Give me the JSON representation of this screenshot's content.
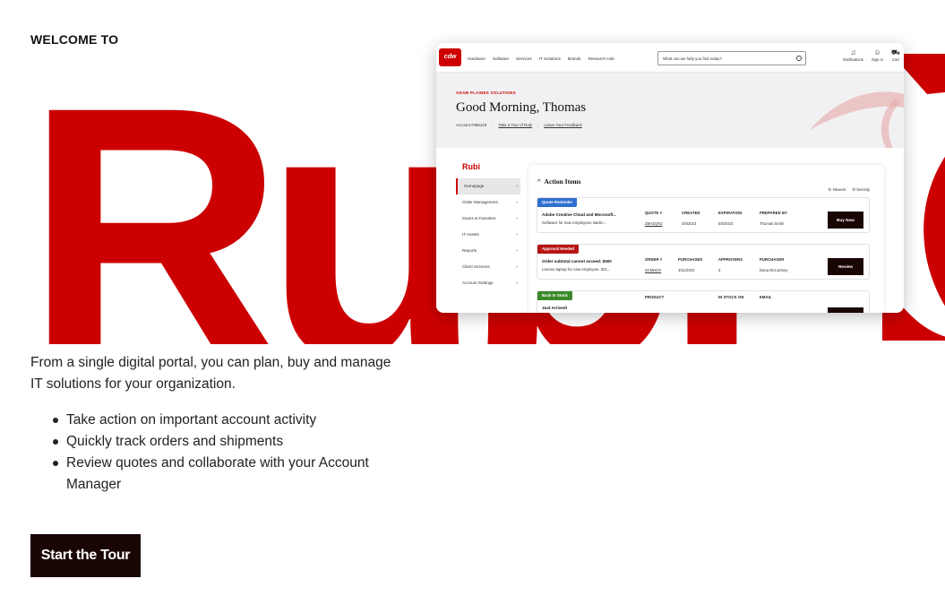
{
  "welcome": "WELCOME TO",
  "hero": {
    "word": "Rubi",
    "registered": "®"
  },
  "intro": "From a single digital portal, you can plan, buy and manage IT solutions for your organization.",
  "bullets": [
    "Take action on important account activity",
    "Quickly track orders and shipments",
    "Review quotes and collaborate with your Account Manager"
  ],
  "cta": "Start the Tour",
  "colors": {
    "brand_red": "#cc0000",
    "dark_button": "#1a0505"
  },
  "screenshot": {
    "logo": "cdw",
    "nav": [
      "Hardware",
      "Software",
      "Services",
      "IT Solutions",
      "Brands",
      "Research Hub"
    ],
    "search_placeholder": "What can we help you find today?",
    "actions": [
      {
        "icon": "bell-icon",
        "glyph": "♫",
        "label": "Notifications"
      },
      {
        "icon": "user-icon",
        "glyph": "☺",
        "label": "Sign In"
      },
      {
        "icon": "cart-icon",
        "glyph": "⛟",
        "label": "Cart"
      }
    ],
    "eyebrow": "ADAM PLAINES SOLUTIONS",
    "greeting": "Good Morning, Thomas",
    "account": "Account #456123",
    "tour_link": "Take a Tour of Rubi",
    "feedback_link": "Leave Your Feedback",
    "sidebar_logo": "Rubi",
    "sidebar": [
      "Homepage",
      "Order Management",
      "Saves & Favorites",
      "IT Assets",
      "Reports",
      "Client Services",
      "Account Settings"
    ],
    "action_items_title": "Action Items",
    "sort_newest": "Newest",
    "sort_density": "Density",
    "items": [
      {
        "badge": "Quote Reminder",
        "badge_color": "#2f6fcf",
        "title": "Adobe Creative Cloud and Microsoft...",
        "subtitle": "Software for new employees startin...",
        "cols": [
          {
            "h": "QUOTE #",
            "v": "ZBHZQN2",
            "link": true
          },
          {
            "h": "CREATED",
            "v": "4/5/2023",
            "link": false
          },
          {
            "h": "EXPIRATION",
            "v": "5/6/2023",
            "link": false
          },
          {
            "h": "PREPARED BY",
            "v": "Thomas Smith",
            "link": false
          }
        ],
        "button": "Buy Now"
      },
      {
        "badge": "Approval Needed",
        "badge_color": "#b81414",
        "title": "Order subtotal cannot exceed: $500",
        "subtitle": "Lenovo laptop for new employee. ID1...",
        "cols": [
          {
            "h": "ORDER #",
            "v": "SCMHDX",
            "link": true
          },
          {
            "h": "PURCHASED",
            "v": "4/11/2023",
            "link": false
          },
          {
            "h": "APPROVERS",
            "v": "3",
            "link": false
          },
          {
            "h": "PURCHASER",
            "v": "Dana McCartney",
            "link": false
          }
        ],
        "button": "Review"
      },
      {
        "badge": "Back In Stock",
        "badge_color": "#3a8a2a",
        "title": "Just Arrived!",
        "subtitle": "",
        "cols": [
          {
            "h": "PRODUCT",
            "v": "",
            "link": false
          },
          {
            "h": "",
            "v": "",
            "link": false
          },
          {
            "h": "IN STOCK ON",
            "v": "",
            "link": false
          },
          {
            "h": "EMAIL",
            "v": "",
            "link": false
          }
        ],
        "button": ""
      }
    ]
  }
}
